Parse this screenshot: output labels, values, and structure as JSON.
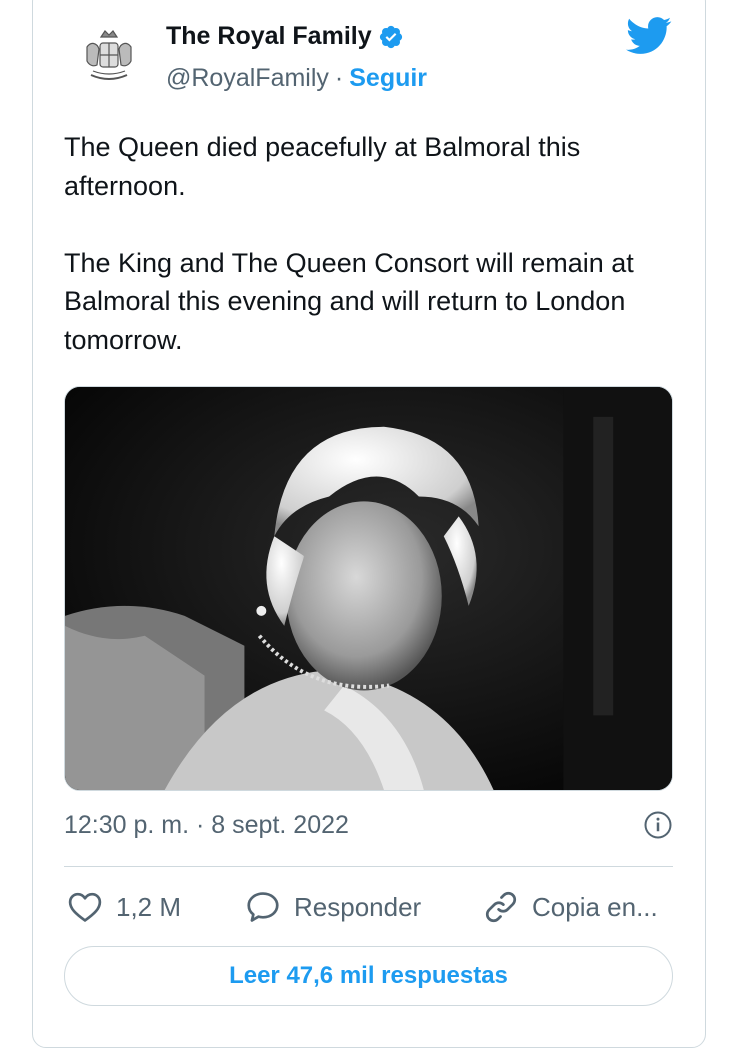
{
  "author": {
    "display_name": "The Royal Family",
    "handle": "@RoyalFamily",
    "separator": "·",
    "follow_label": "Seguir",
    "avatar_icon": "royal-coat-of-arms",
    "verified_icon": "verified-badge-icon"
  },
  "platform_icon": "twitter-bird-icon",
  "tweet": {
    "paragraph_1": "The Queen died peacefully at Balmoral this afternoon.",
    "paragraph_2": "The King and The Queen Consort will remain at Balmoral this evening and will return to London tomorrow."
  },
  "meta": {
    "timestamp": "12:30 p. m. · 8 sept. 2022"
  },
  "actions": {
    "like_count": "1,2 M",
    "reply_label": "Responder",
    "copy_label": "Copia en..."
  },
  "read_replies_label": "Leer 47,6 mil respuestas",
  "colors": {
    "accent": "#1d9bf0",
    "text": "#0f1419",
    "muted": "#536471",
    "border": "#cfd9de"
  }
}
